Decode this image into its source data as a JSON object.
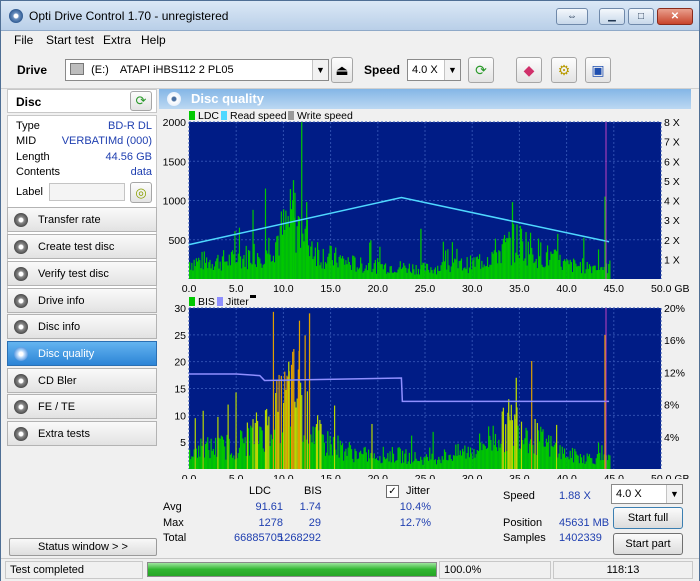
{
  "window": {
    "title": "Opti Drive Control 1.70 - unregistered"
  },
  "menu": [
    "File",
    "Start test",
    "Extra",
    "Help"
  ],
  "toolbar": {
    "drive_label": "Drive",
    "drive_letter": "(E:)",
    "drive_value": "ATAPI iHBS112   2 PL05",
    "speed_label": "Speed",
    "speed_value": "4.0 X"
  },
  "disc": {
    "header": "Disc",
    "fields": [
      {
        "label": "Type",
        "value": "BD-R DL"
      },
      {
        "label": "MID",
        "value": "VERBATIMd (000)"
      },
      {
        "label": "Length",
        "value": "44.56 GB"
      },
      {
        "label": "Contents",
        "value": "data"
      },
      {
        "label": "Label",
        "value": ""
      }
    ]
  },
  "nav": [
    "Transfer rate",
    "Create test disc",
    "Verify test disc",
    "Drive info",
    "Disc info",
    "Disc quality",
    "CD Bler",
    "FE / TE",
    "Extra tests"
  ],
  "nav_active": "Disc quality",
  "status_window_label": "Status window > >",
  "panel": {
    "title": "Disc quality"
  },
  "chart_top": {
    "legend": [
      "LDC",
      "Read speed",
      "Write speed"
    ],
    "y_ticks": [
      "2000",
      "1500",
      "1000",
      "500"
    ],
    "y2_ticks": [
      "8 X",
      "7 X",
      "6 X",
      "5 X",
      "4 X",
      "3 X",
      "2 X",
      "1 X"
    ],
    "x_ticks": [
      "0.0",
      "5.0",
      "10.0",
      "15.0",
      "20.0",
      "25.0",
      "30.0",
      "35.0",
      "40.0",
      "45.0",
      "50.0 GB"
    ]
  },
  "chart_bottom": {
    "legend": [
      "BIS",
      "Jitter"
    ],
    "y_ticks": [
      "30",
      "25",
      "20",
      "15",
      "10",
      "5"
    ],
    "y2_ticks": [
      "20%",
      "16%",
      "12%",
      "8%",
      "4%"
    ],
    "x_ticks": [
      "0.0",
      "5.0",
      "10.0",
      "15.0",
      "20.0",
      "25.0",
      "30.0",
      "35.0",
      "40.0",
      "45.0",
      "50.0 GB"
    ]
  },
  "chart_data": [
    {
      "type": "bar",
      "x_unit": "GB",
      "xlim": [
        0,
        50
      ],
      "ylim": [
        0,
        2000
      ],
      "y2lim": [
        0,
        8
      ],
      "series": [
        {
          "name": "LDC",
          "color": "#00c800",
          "profile": [
            [
              0,
              250
            ],
            [
              5,
              280
            ],
            [
              8,
              420
            ],
            [
              10,
              700
            ],
            [
              11,
              900
            ],
            [
              12,
              650
            ],
            [
              14,
              350
            ],
            [
              18,
              200
            ],
            [
              22,
              180
            ],
            [
              25,
              150
            ],
            [
              30,
              220
            ],
            [
              33,
              420
            ],
            [
              35,
              550
            ],
            [
              37,
              380
            ],
            [
              40,
              200
            ],
            [
              44,
              180
            ]
          ]
        },
        {
          "name": "Read speed",
          "color": "#4fd8ff",
          "points": [
            [
              0,
              1.75
            ],
            [
              22.5,
              4.15
            ],
            [
              44.5,
              1.9
            ]
          ]
        }
      ]
    },
    {
      "type": "bar",
      "x_unit": "GB",
      "xlim": [
        0,
        50
      ],
      "ylim": [
        0,
        30
      ],
      "y2lim": [
        0,
        20
      ],
      "series": [
        {
          "name": "BIS",
          "color": "#00c800",
          "profile": [
            [
              0,
              4
            ],
            [
              5,
              5
            ],
            [
              8,
              9
            ],
            [
              10,
              14
            ],
            [
              11,
              17
            ],
            [
              12,
              12
            ],
            [
              14,
              6
            ],
            [
              18,
              3
            ],
            [
              22,
              3
            ],
            [
              25,
              2
            ],
            [
              30,
              4
            ],
            [
              33,
              8
            ],
            [
              35,
              10
            ],
            [
              37,
              6
            ],
            [
              40,
              3
            ],
            [
              44,
              2
            ]
          ]
        },
        {
          "name": "Jitter",
          "color": "#8f8fff",
          "points": [
            [
              0,
              11.8
            ],
            [
              5,
              11.8
            ],
            [
              7.5,
              11.6
            ],
            [
              8,
              11.0
            ],
            [
              22.5,
              11.3
            ],
            [
              22.6,
              8.4
            ],
            [
              44.5,
              8.4
            ]
          ]
        }
      ]
    }
  ],
  "stats": {
    "headers": {
      "ldc": "LDC",
      "bis": "BIS",
      "jitter": "Jitter"
    },
    "jitter_checked": "✓",
    "avg": {
      "label": "Avg",
      "ldc": "91.61",
      "bis": "1.74",
      "jitter": "10.4%"
    },
    "max": {
      "label": "Max",
      "ldc": "1278",
      "bis": "29",
      "jitter": "12.7%"
    },
    "total": {
      "label": "Total",
      "ldc": "66885705",
      "bis": "1268292"
    },
    "speed_label": "Speed",
    "speed_value": "1.88 X",
    "speed_combo": "4.0 X",
    "position_label": "Position",
    "position_value": "45631 MB",
    "samples_label": "Samples",
    "samples_value": "1402339",
    "start_full": "Start full",
    "start_part": "Start part"
  },
  "statusbar": {
    "text": "Test completed",
    "progress": 1.0,
    "progress_text": "100.0%",
    "time": "118:13"
  }
}
